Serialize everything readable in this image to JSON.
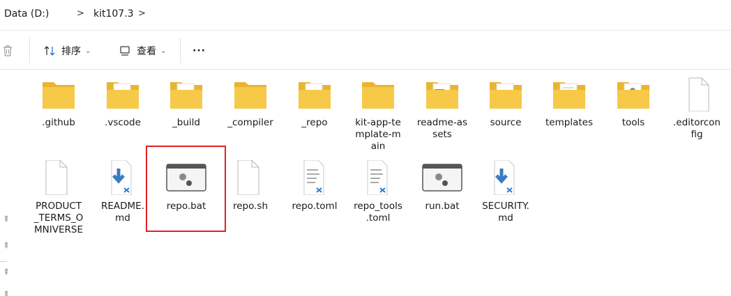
{
  "breadcrumb": {
    "drive": "Data (D:)",
    "folder": "kit107.3",
    "separator": ">"
  },
  "toolbar": {
    "sort_label": "排序",
    "view_label": "查看",
    "more_label": "···"
  },
  "files": [
    {
      "name": ".github",
      "type": "folder"
    },
    {
      "name": ".vscode",
      "type": "folder-doc"
    },
    {
      "name": "_build",
      "type": "folder-doc"
    },
    {
      "name": "_compiler",
      "type": "folder"
    },
    {
      "name": "_repo",
      "type": "folder-doc"
    },
    {
      "name": "kit-app-template-main",
      "type": "folder"
    },
    {
      "name": "readme-assets",
      "type": "folder-image"
    },
    {
      "name": "source",
      "type": "folder-doc"
    },
    {
      "name": "templates",
      "type": "folder-doc"
    },
    {
      "name": "tools",
      "type": "folder-gear"
    },
    {
      "name": ".editorconfig",
      "type": "file"
    },
    {
      "name": "PRODUCT_TERMS_OMNIVERSE",
      "type": "file"
    },
    {
      "name": "README.md",
      "type": "markdown"
    },
    {
      "name": "repo.bat",
      "type": "batch"
    },
    {
      "name": "repo.sh",
      "type": "file"
    },
    {
      "name": "repo.toml",
      "type": "text-vscode"
    },
    {
      "name": "repo_tools.toml",
      "type": "text-vscode"
    },
    {
      "name": "run.bat",
      "type": "batch"
    },
    {
      "name": "SECURITY.md",
      "type": "markdown"
    }
  ],
  "labels": {
    "github": ".github",
    "vscode": ".vscode",
    "build": "_build",
    "compiler": "_compiler",
    "repo": "_repo",
    "kit_l1": "kit-app-te",
    "kit_l2": "mplate-m",
    "kit_l3": "ain",
    "readme_l1": "readme-as",
    "readme_l2": "sets",
    "source": "source",
    "templates": "templates",
    "tools": "tools",
    "editor_l1": ".editorcon",
    "editor_l2": "fig",
    "product_l1": "PRODUCT",
    "product_l2": "_TERMS_O",
    "product_l3": "MNIVERSE",
    "readmemd_l1": "README.",
    "readmemd_l2": "md",
    "repobat": "repo.bat",
    "reposh": "repo.sh",
    "repotoml": "repo.toml",
    "repotools_l1": "repo_tools",
    "repotools_l2": ".toml",
    "runbat": "run.bat",
    "security_l1": "SECURITY.",
    "security_l2": "md"
  },
  "colors": {
    "folder": "#f4c542",
    "folder_light": "#fbd96a",
    "highlight": "#e02020",
    "vscode_blue": "#2a7fd4",
    "download_blue": "#3a7bbf"
  }
}
